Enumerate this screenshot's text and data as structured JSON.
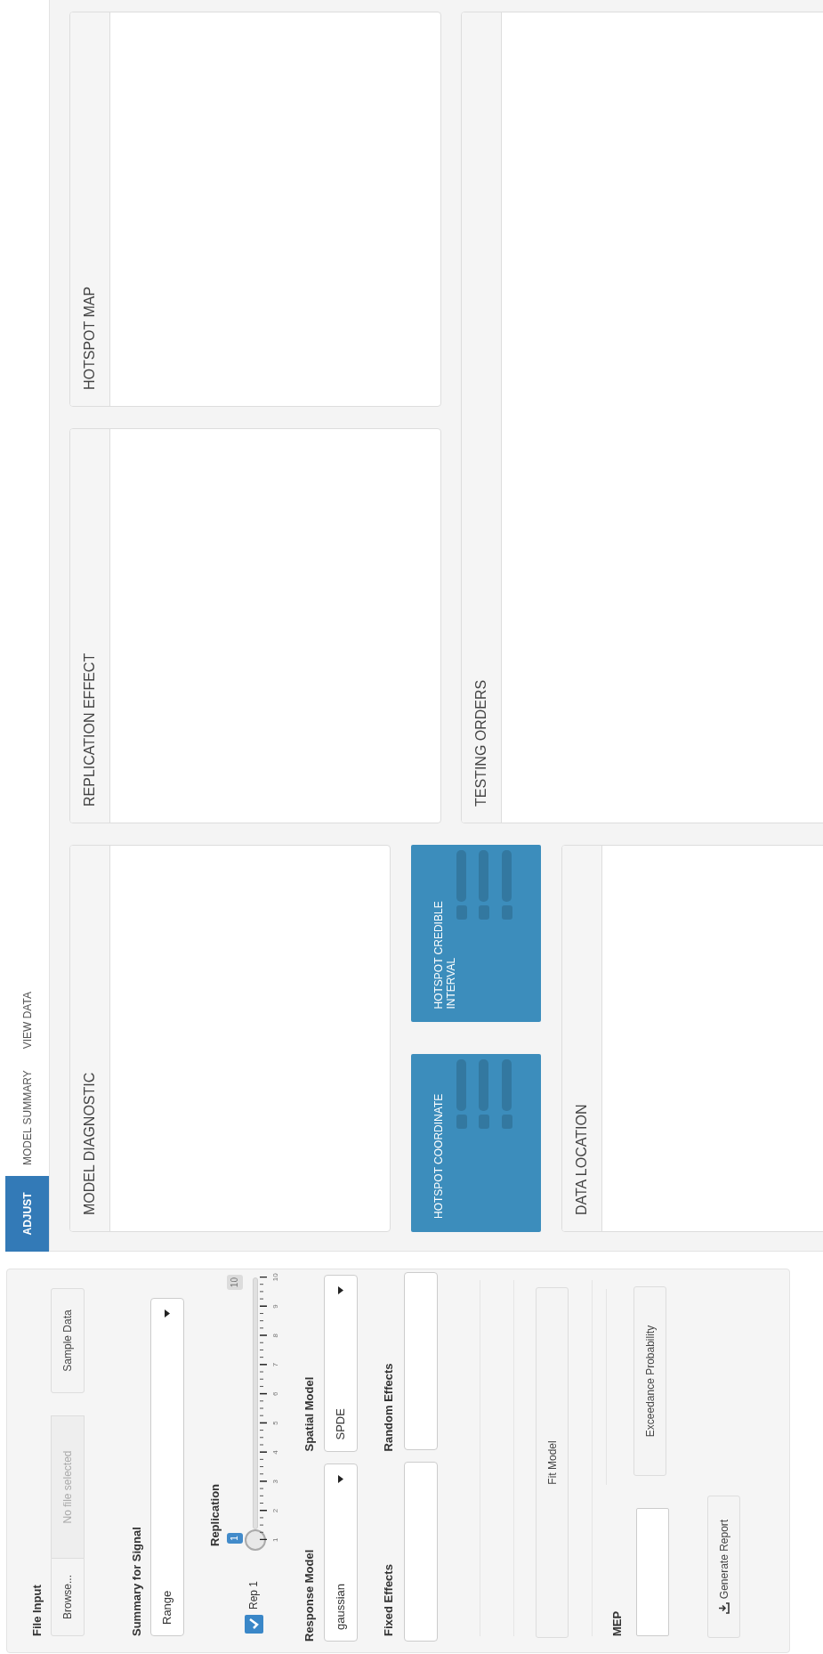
{
  "sidebar": {
    "file_input": {
      "label": "File Input",
      "browse_button": "Browse...",
      "file_field": "No file selected",
      "sample_button": "Sample Data"
    },
    "summary": {
      "label": "Summary for Signal",
      "value": "Range"
    },
    "replication": {
      "label": "Replication",
      "checkbox": {
        "label": "Rep 1",
        "checked": true
      },
      "slider": {
        "value_label": "1",
        "max_label": "10",
        "ticks": [
          "1",
          "2",
          "3",
          "4",
          "5",
          "6",
          "7",
          "8",
          "9",
          "10"
        ],
        "level": 0
      }
    },
    "response_model": {
      "label": "Response Model",
      "value": "gaussian"
    },
    "spatial_model": {
      "label": "Spatial Model",
      "value": "SPDE"
    },
    "fixed_effects": {
      "label": "Fixed Effects"
    },
    "random_effects": {
      "label": "Random Effects"
    },
    "fit_button": "Fit Model",
    "mep": {
      "label": "MEP"
    },
    "exceedance_button": "Exceedance Probability",
    "report_button": "Generate Report"
  },
  "tabs": [
    {
      "label": "ADJUST",
      "selected": true
    },
    {
      "label": "MODEL SUMMARY",
      "selected": false
    },
    {
      "label": "VIEW DATA",
      "selected": false
    }
  ],
  "panels": {
    "model_diagnostic": "MODEL DIAGNOSTIC",
    "replication_effect": "REPLICATION EFFECT",
    "hotspot_map": "HOTSPOT MAP",
    "data_location": "DATA LOCATION",
    "testing_orders": "TESTING ORDERS"
  },
  "value_boxes": [
    {
      "title": "HOTSPOT COORDINATE"
    },
    {
      "title": "HOTSPOT CREDIBLE INTERVAL"
    }
  ]
}
